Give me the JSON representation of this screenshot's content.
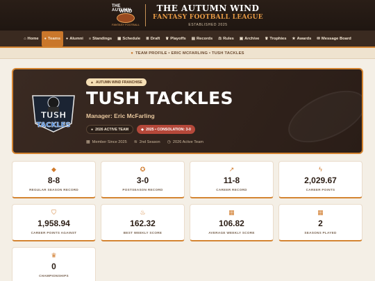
{
  "header": {
    "logo_line1": "THE AUTUMN",
    "logo_line2": "WIND",
    "logo_line3": "FANTASY FOOTBALL",
    "title": "THE AUTUMN WIND",
    "subtitle": "FANTASY FOOTBALL LEAGUE",
    "established": "ESTABLISHED 2025"
  },
  "nav": {
    "items": [
      {
        "label": "Home",
        "icon": "home-icon"
      },
      {
        "label": "Teams",
        "icon": "users-icon"
      },
      {
        "label": "Alumni",
        "icon": "alumni-icon"
      },
      {
        "label": "Standings",
        "icon": "standings-icon"
      },
      {
        "label": "Schedule",
        "icon": "calendar-icon"
      },
      {
        "label": "Draft",
        "icon": "draft-icon"
      },
      {
        "label": "Playoffs",
        "icon": "trophy-icon"
      },
      {
        "label": "Records",
        "icon": "records-icon"
      },
      {
        "label": "Rules",
        "icon": "rules-icon"
      },
      {
        "label": "Archive",
        "icon": "archive-icon"
      },
      {
        "label": "Trophies",
        "icon": "trophies-icon"
      },
      {
        "label": "Awards",
        "icon": "awards-icon"
      },
      {
        "label": "Message Board",
        "icon": "message-icon"
      }
    ],
    "active": "Teams"
  },
  "breadcrumb": "TEAM PROFILE • ERIC MCFARLING • TUSH TACKLES",
  "team_logo": {
    "line1": "TUSH",
    "line2": "TACKLES"
  },
  "hero": {
    "franchise_label": "AUTUMN WIND FRANCHISE",
    "team_name": "TUSH TACKLES",
    "manager": "Manager: Eric McFarling",
    "badge_active": "2026 ACTIVE TEAM",
    "badge_consolation": "2025 • CONSOLATION: 3-0",
    "meta_since": "Member Since 2025",
    "meta_season": "2nd Season",
    "meta_active": "2026 Active Team"
  },
  "stats": [
    {
      "value": "8-8",
      "label": "REGULAR SEASON RECORD",
      "icon": "football-icon"
    },
    {
      "value": "3-0",
      "label": "POSTSEASON RECORD",
      "icon": "medal-icon"
    },
    {
      "value": "11-8",
      "label": "CAREER RECORD",
      "icon": "chart-line-icon"
    },
    {
      "value": "2,029.67",
      "label": "CAREER POINTS",
      "icon": "bolt-icon"
    },
    {
      "value": "1,958.94",
      "label": "CAREER POINTS AGAINST",
      "icon": "shield-icon"
    },
    {
      "value": "162.32",
      "label": "BEST WEEKLY SCORE",
      "icon": "fire-icon"
    },
    {
      "value": "106.82",
      "label": "AVERAGE WEEKLY SCORE",
      "icon": "calculator-icon"
    },
    {
      "value": "2",
      "label": "SEASONS PLAYED",
      "icon": "calendar-icon"
    },
    {
      "value": "0",
      "label": "CHAMPIONSHIPS",
      "icon": "trophy-icon"
    }
  ],
  "colors": {
    "accent": "#d48431",
    "header_bg": "#2a1e17",
    "hero_bg": "#3a2a22",
    "badge_red": "#b5483a",
    "page_bg": "#f4efe6"
  }
}
